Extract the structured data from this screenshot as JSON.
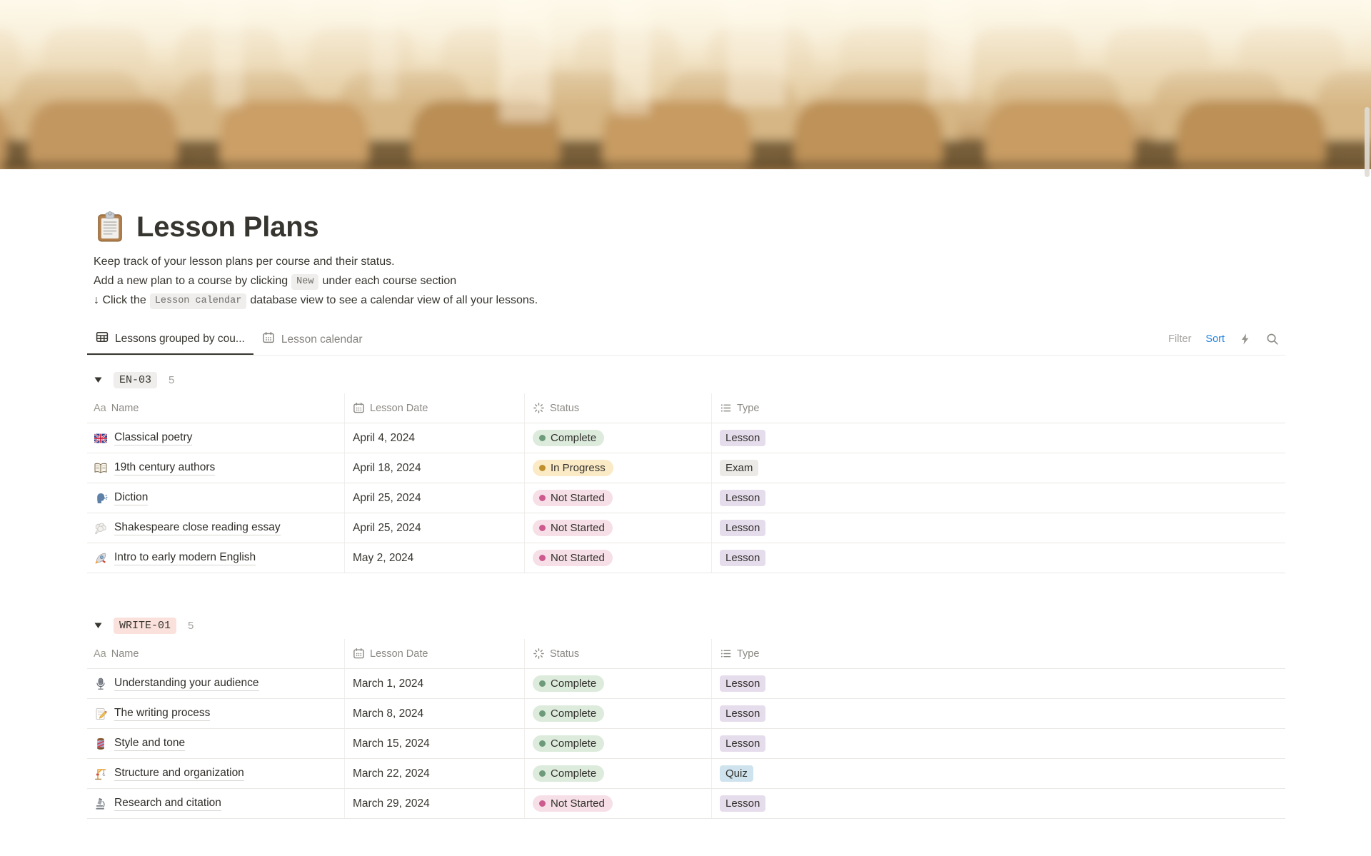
{
  "page": {
    "title": "Lesson Plans",
    "icon": "clipboard"
  },
  "description": {
    "line1": "Keep track of your lesson plans per course and their status.",
    "line2_prefix": "Add a new plan to a course by clicking",
    "line2_code": "New",
    "line2_suffix": "under each course section",
    "line3_prefix": "↓ Click the",
    "line3_code": "Lesson calendar",
    "line3_suffix": "database view to see a calendar view of all your lessons."
  },
  "toolbar": {
    "tabs": [
      {
        "label": "Lessons grouped by cou...",
        "icon": "table-icon",
        "active": true
      },
      {
        "label": "Lesson calendar",
        "icon": "calendar-icon",
        "active": false
      }
    ],
    "filter_label": "Filter",
    "sort_label": "Sort",
    "action_icons": [
      "lightning-icon",
      "search-icon"
    ]
  },
  "columns": [
    {
      "icon": "aa-icon",
      "label": "Name"
    },
    {
      "icon": "calendar-icon",
      "label": "Lesson Date"
    },
    {
      "icon": "status-spinner-icon",
      "label": "Status"
    },
    {
      "icon": "list-icon",
      "label": "Type"
    }
  ],
  "groups": [
    {
      "badge": "EN-03",
      "badge_bg": "#EFEEEC",
      "count": "5",
      "rows": [
        {
          "icon": "uk-flag",
          "name": "Classical poetry",
          "date": "April 4, 2024",
          "status": "Complete",
          "type": "Lesson"
        },
        {
          "icon": "open-book",
          "name": "19th century authors",
          "date": "April 18, 2024",
          "status": "In Progress",
          "type": "Exam"
        },
        {
          "icon": "speaking-head",
          "name": "Diction",
          "date": "April 25, 2024",
          "status": "Not Started",
          "type": "Lesson"
        },
        {
          "icon": "thought-balloon",
          "name": "Shakespeare close reading essay",
          "date": "April 25, 2024",
          "status": "Not Started",
          "type": "Lesson"
        },
        {
          "icon": "rocket",
          "name": "Intro to early modern English",
          "date": "May 2, 2024",
          "status": "Not Started",
          "type": "Lesson"
        }
      ]
    },
    {
      "badge": "WRITE-01",
      "badge_bg": "#FBE1DC",
      "count": "5",
      "rows": [
        {
          "icon": "microphone",
          "name": "Understanding your audience",
          "date": "March 1, 2024",
          "status": "Complete",
          "type": "Lesson"
        },
        {
          "icon": "memo",
          "name": "The writing process",
          "date": "March 8, 2024",
          "status": "Complete",
          "type": "Lesson"
        },
        {
          "icon": "thread",
          "name": "Style and tone",
          "date": "March 15, 2024",
          "status": "Complete",
          "type": "Lesson"
        },
        {
          "icon": "crane",
          "name": "Structure and organization",
          "date": "March 22, 2024",
          "status": "Complete",
          "type": "Quiz"
        },
        {
          "icon": "microscope",
          "name": "Research and citation",
          "date": "March 29, 2024",
          "status": "Not Started",
          "type": "Lesson"
        }
      ]
    }
  ],
  "status_styles": {
    "Complete": {
      "bg": "#DCEBDC",
      "dot": "#6D9B79"
    },
    "In Progress": {
      "bg": "#FAEAC5",
      "dot": "#BE8F2D"
    },
    "Not Started": {
      "bg": "#F6DFE7",
      "dot": "#CC5A8E"
    }
  },
  "type_styles": {
    "Lesson": {
      "bg": "#E6DDEC"
    },
    "Exam": {
      "bg": "#EBEAE7"
    },
    "Quiz": {
      "bg": "#CFE3EE"
    }
  },
  "colors": {
    "accent_blue": "#2383E2",
    "text": "#37352F",
    "gray_text": "#787774",
    "divider": "#E9E8E5"
  }
}
